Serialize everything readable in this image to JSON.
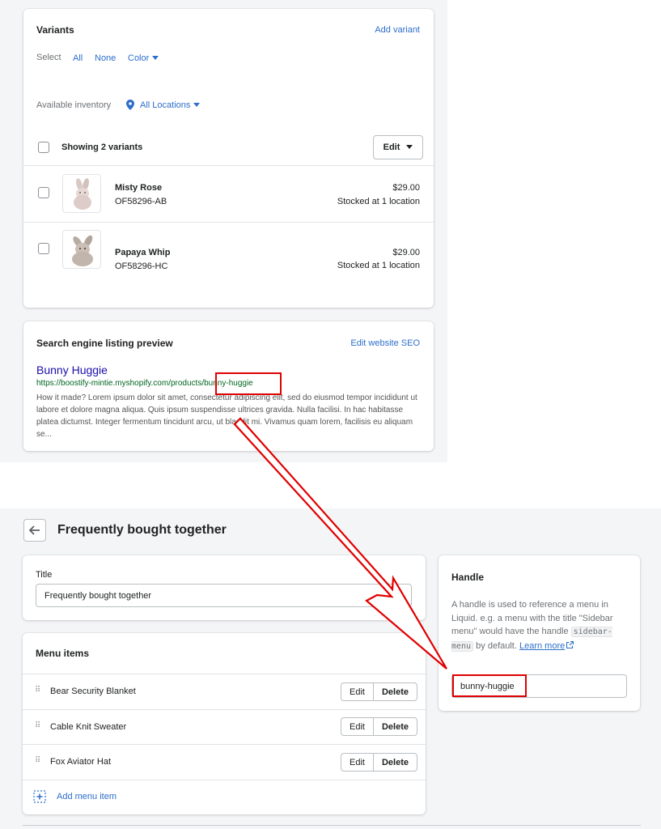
{
  "variants": {
    "title": "Variants",
    "add_variant": "Add variant",
    "select_label": "Select",
    "select_all": "All",
    "select_none": "None",
    "select_color": "Color",
    "inventory_label": "Available inventory",
    "locations": "All Locations",
    "showing": "Showing 2 variants",
    "edit": "Edit",
    "items": [
      {
        "name": "Misty Rose",
        "sku": "OF58296-AB",
        "price": "$29.00",
        "stock": "Stocked at 1 location"
      },
      {
        "name": "Papaya Whip",
        "sku": "OF58296-HC",
        "price": "$29.00",
        "stock": "Stocked at 1 location"
      }
    ]
  },
  "seo": {
    "title": "Search engine listing preview",
    "edit_link": "Edit website SEO",
    "page_title": "Bunny Huggie",
    "url_prefix": "https://boostify-mintie.myshopify.com/products/",
    "url_handle": "bunny-huggie",
    "description": "How it made? Lorem ipsum dolor sit amet, consectetur adipiscing elit, sed do eiusmod tempor incididunt ut labore et dolore magna aliqua. Quis ipsum suspendisse ultrices gravida. Nulla facilisi. In hac habitasse platea dictumst. Integer fermentum tincidunt arcu, ut blandit mi. Vivamus quam lorem, facilisis eu aliquam se..."
  },
  "menu_page": {
    "heading": "Frequently bought together",
    "title_label": "Title",
    "title_value": "Frequently bought together",
    "menu_items_title": "Menu items",
    "items": [
      {
        "label": "Bear Security Blanket"
      },
      {
        "label": "Cable Knit Sweater"
      },
      {
        "label": "Fox Aviator Hat"
      }
    ],
    "edit": "Edit",
    "delete": "Delete",
    "add_item": "Add menu item"
  },
  "handle": {
    "title": "Handle",
    "help_1": "A handle is used to reference a menu in Liquid. e.g. a menu with the title \"Sidebar menu\" would have the handle",
    "code": "sidebar-menu",
    "help_2": "by default.",
    "learn_more": "Learn more",
    "value": "bunny-huggie"
  },
  "colors": {
    "accent": "#2c6ecb",
    "annotation": "#e00000",
    "seo_title": "#1a0dab",
    "seo_url": "#006621"
  }
}
